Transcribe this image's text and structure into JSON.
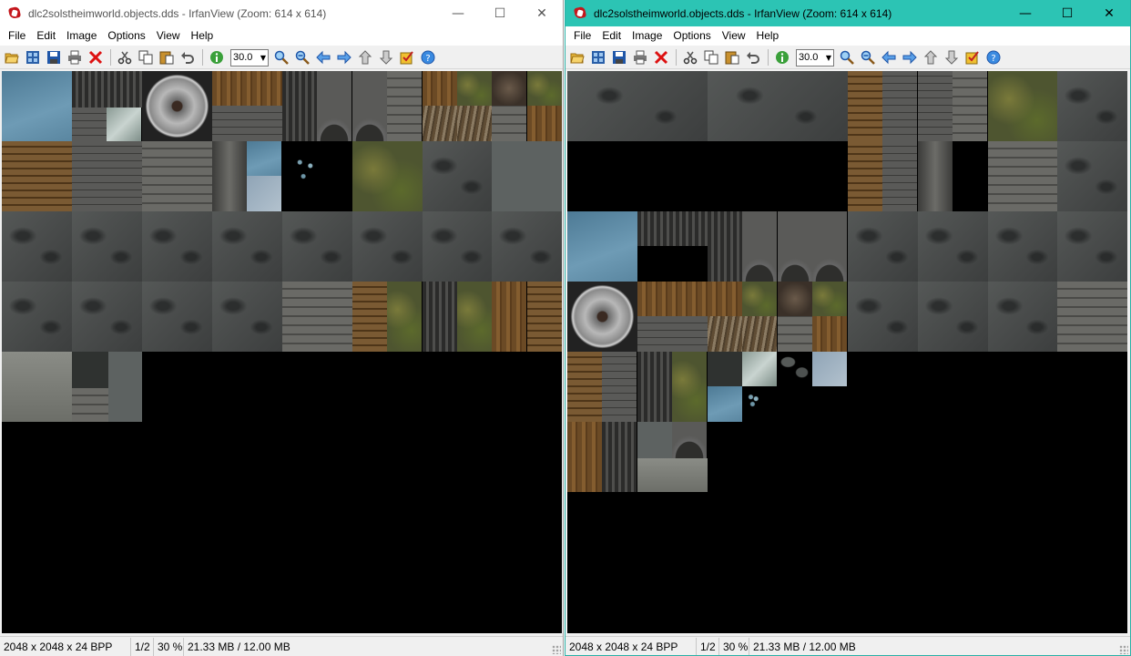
{
  "windows": [
    {
      "title": "dlc2solstheimworld.objects.dds - IrfanView (Zoom: 614 x 614)",
      "active": false,
      "status": {
        "dimensions": "2048 x 2048 x 24 BPP",
        "page": "1/2",
        "zoom": "30 %",
        "memory": "21.33 MB / 12.00 MB"
      }
    },
    {
      "title": "dlc2solstheimworld.objects.dds - IrfanView (Zoom: 614 x 614)",
      "active": true,
      "status": {
        "dimensions": "2048 x 2048 x 24 BPP",
        "page": "1/2",
        "zoom": "30 %",
        "memory": "21.33 MB / 12.00 MB"
      }
    }
  ],
  "menu": [
    "File",
    "Edit",
    "Image",
    "Options",
    "View",
    "Help"
  ],
  "toolbar": {
    "zoom_value": "30.0",
    "icons": [
      "open-icon",
      "thumbnails-icon",
      "save-icon",
      "print-icon",
      "delete-icon",
      "cut-icon",
      "copy-icon",
      "paste-icon",
      "undo-icon",
      "info-icon",
      "zoom-in-icon",
      "zoom-out-icon",
      "previous-icon",
      "next-icon",
      "page-up-icon",
      "page-down-icon",
      "paint-icon",
      "help-icon"
    ]
  },
  "window_controls": {
    "minimize": "—",
    "maximize": "☐",
    "close": "✕"
  },
  "colors": {
    "active_titlebar": "#2cc4b4",
    "inactive_titlebar": "#ffffff",
    "canvas_background": "#000000"
  }
}
